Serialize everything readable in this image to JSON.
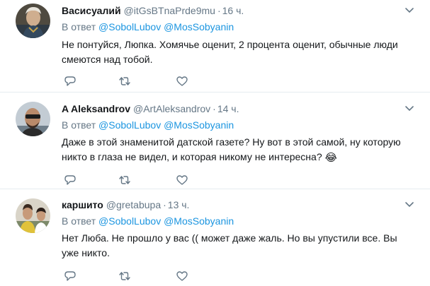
{
  "tweets": [
    {
      "name": "Васисуалий",
      "handle": "@itGsBTnaPrde9mu",
      "time": "16 ч.",
      "reply_prefix": "В ответ",
      "mentions": [
        "@SobolLubov",
        "@MosSobyanin"
      ],
      "text": "Не понтуйся, Люпка. Хомячье оценит, 2 процента оценит, обычные люди смеются над тобой.",
      "emoji": ""
    },
    {
      "name": "A Aleksandrov",
      "handle": "@ArtAleksandrov",
      "time": "14 ч.",
      "reply_prefix": "В ответ",
      "mentions": [
        "@SobolLubov",
        "@MosSobyanin"
      ],
      "text": "Даже в этой знаменитой датской газете? Ну вот в этой самой, ну которую никто в глаза не видел, и которая никому не интересна?",
      "emoji": "😂"
    },
    {
      "name": "каршито",
      "handle": "@gretabupa",
      "time": "13 ч.",
      "reply_prefix": "В ответ",
      "mentions": [
        "@SobolLubov",
        "@MosSobyanin"
      ],
      "text": "Нет Люба. Не прошло у вас (( может даже жаль. Но вы упустили все. Вы уже никто.",
      "emoji": ""
    }
  ],
  "separator": "·",
  "icons": {
    "menu": "chevron-down-icon",
    "reply": "reply-icon",
    "retweet": "retweet-icon",
    "like": "heart-icon"
  },
  "colors": {
    "text": "#14171a",
    "secondary": "#657786",
    "link": "#1b95e0",
    "divider": "#e6ecf0",
    "icon": "#657786"
  }
}
